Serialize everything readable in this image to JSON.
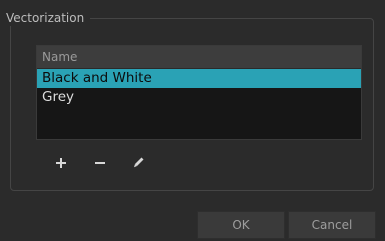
{
  "group": {
    "title": "Vectorization"
  },
  "list": {
    "header": "Name",
    "items": [
      "Black and White",
      "Grey"
    ],
    "selected_index": 0
  },
  "toolbar": {
    "add_icon": "plus-icon",
    "remove_icon": "minus-icon",
    "edit_icon": "pen-icon"
  },
  "buttons": {
    "ok_label": "OK",
    "cancel_label": "Cancel"
  },
  "colors": {
    "selection": "#2aa2b5",
    "background": "#2b2b2b",
    "list_background": "#161616"
  }
}
